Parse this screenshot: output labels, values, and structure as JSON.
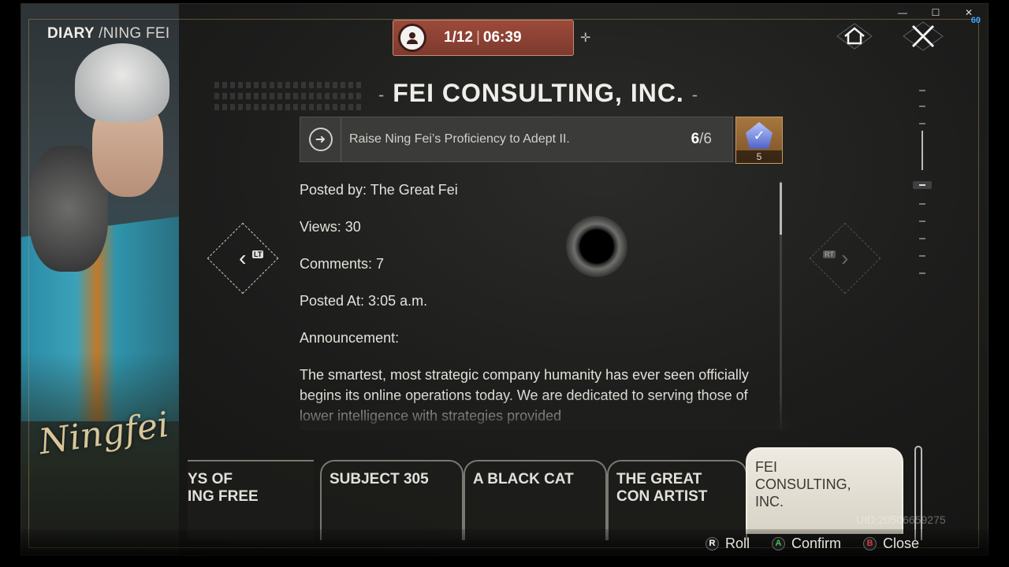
{
  "window": {
    "minimize_glyph": "—",
    "maximize_glyph": "☐",
    "close_glyph": "✕",
    "fps": "60"
  },
  "header": {
    "section": "DIARY",
    "subsection": "/NING FEI",
    "signature": "Ningfei"
  },
  "timer": {
    "progress": "1/12",
    "time": "06:39"
  },
  "entry": {
    "title": "FEI CONSULTING, INC.",
    "quest": {
      "text": "Raise Ning Fei’s Proficiency to Adept II.",
      "current": "6",
      "total": "/6",
      "reward_count": "5"
    },
    "posted_by": "Posted by: The Great Fei",
    "views": "Views: 30",
    "comments": "Comments: 7",
    "posted_at": "Posted At: 3:05 a.m.",
    "announcement_label": "Announcement:",
    "body": "The smartest, most strategic company humanity has ever seen officially begins its online operations today. We are dedicated to serving those of lower intelligence with strategies provided"
  },
  "nav": {
    "left_tag": "LT",
    "right_tag": "RT"
  },
  "tabs": [
    {
      "label": "YS OF\nING FREE"
    },
    {
      "label": "SUBJECT 305"
    },
    {
      "label": "A BLACK CAT"
    },
    {
      "label": "THE GREAT\nCON ARTIST"
    },
    {
      "label": "FEI\nCONSULTING,\nINC."
    }
  ],
  "footer": {
    "roll_key": "R",
    "roll_label": "Roll",
    "confirm_key": "A",
    "confirm_label": "Confirm",
    "close_key": "B",
    "close_label": "Close",
    "uid": "UID:20506659275"
  },
  "colors": {
    "accent_timer": "#9c4a3a",
    "confirm_glyph": "#3fbf55",
    "close_glyph": "#d23a3a"
  }
}
